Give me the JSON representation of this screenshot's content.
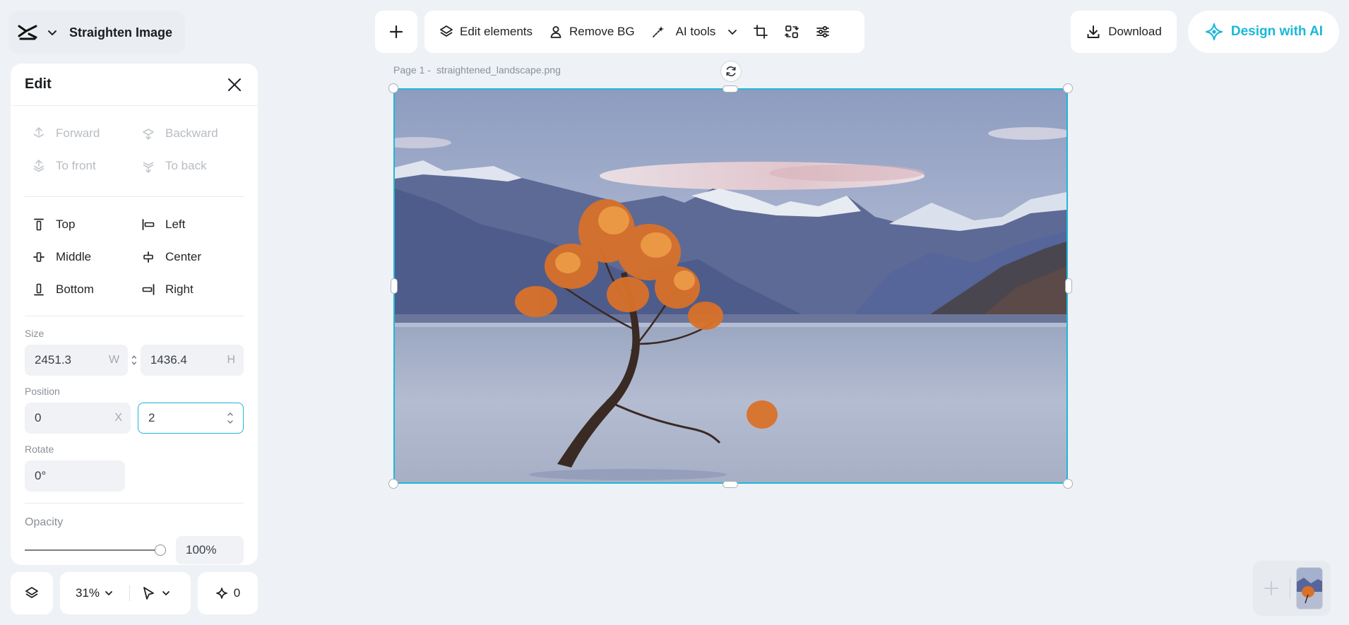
{
  "brand": {
    "doc_title": "Straighten Image"
  },
  "toolbar": {
    "edit_elements": "Edit elements",
    "remove_bg": "Remove BG",
    "ai_tools": "AI tools"
  },
  "actions": {
    "download": "Download",
    "design_ai": "Design with AI"
  },
  "panel": {
    "title": "Edit",
    "layer_options": [
      {
        "label": "Forward",
        "enabled": false
      },
      {
        "label": "Backward",
        "enabled": false
      },
      {
        "label": "To front",
        "enabled": false
      },
      {
        "label": "To back",
        "enabled": false
      }
    ],
    "align_options": [
      "Top",
      "Left",
      "Middle",
      "Center",
      "Bottom",
      "Right"
    ],
    "size": {
      "label": "Size",
      "width": "2451.3",
      "width_unit": "W",
      "height": "1436.4",
      "height_unit": "H"
    },
    "position": {
      "label": "Position",
      "x": "0",
      "x_unit": "X",
      "y": "2"
    },
    "rotate": {
      "label": "Rotate",
      "value": "0°"
    },
    "opacity": {
      "label": "Opacity",
      "value": "100%",
      "fraction": 1.0
    }
  },
  "bottom": {
    "zoom": "31%",
    "counter": "0"
  },
  "canvas": {
    "page_label": "Page 1 -",
    "file_name": "straightened_landscape.png"
  },
  "colors": {
    "accent": "#1ab8d8",
    "background": "#eef2f6",
    "panel": "#ffffff"
  }
}
